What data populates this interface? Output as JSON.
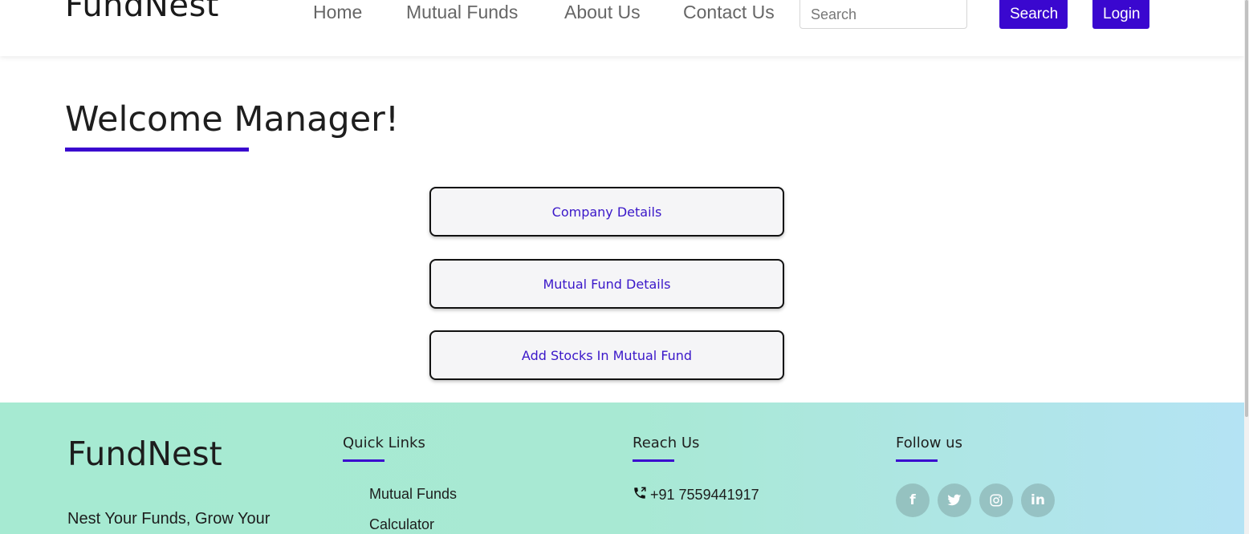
{
  "header": {
    "brand": "FundNest",
    "nav": [
      "Home",
      "Mutual Funds",
      "About Us",
      "Contact Us"
    ],
    "search_placeholder": "Search",
    "search_button": "Search",
    "login_button": "Login"
  },
  "main": {
    "welcome": "Welcome Manager!",
    "actions": [
      "Company Details",
      "Mutual Fund Details",
      "Add Stocks In Mutual Fund"
    ]
  },
  "footer": {
    "brand": "FundNest",
    "tagline": "Nest Your Funds, Grow Your",
    "quick_links_heading": "Quick Links",
    "quick_links": [
      "Mutual Funds",
      "Calculator"
    ],
    "reach_us_heading": "Reach Us",
    "phone": "+91 7559441917",
    "follow_us_heading": "Follow us",
    "social": [
      {
        "icon": "facebook-icon",
        "glyph": "f"
      },
      {
        "icon": "twitter-icon",
        "glyph": "t"
      },
      {
        "icon": "instagram-icon",
        "glyph": "◎"
      },
      {
        "icon": "linkedin-icon",
        "glyph": "in"
      }
    ]
  },
  "colors": {
    "accent": "#3a07cf",
    "footer_start": "#a6ead2",
    "footer_end": "#b4e3f4"
  }
}
